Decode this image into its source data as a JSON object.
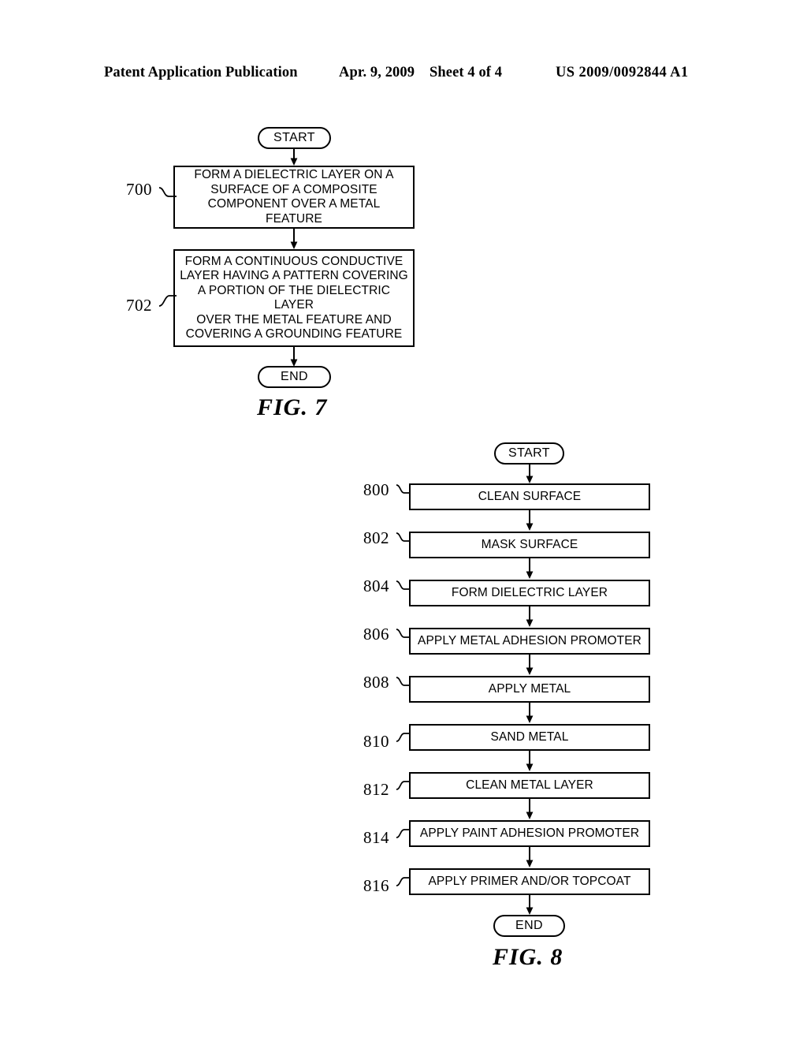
{
  "header": {
    "publication": "Patent Application Publication",
    "date": "Apr. 9, 2009",
    "sheet": "Sheet 4 of 4",
    "patent_number": "US 2009/0092844 A1"
  },
  "figures": [
    {
      "caption": "FIG. 7",
      "start_label": "START",
      "end_label": "END",
      "steps": [
        {
          "ref": "700",
          "text": "FORM A DIELECTRIC LAYER ON A\nSURFACE OF A COMPOSITE\nCOMPONENT OVER A METAL FEATURE"
        },
        {
          "ref": "702",
          "text": "FORM A CONTINUOUS CONDUCTIVE\nLAYER HAVING A PATTERN COVERING\nA PORTION OF THE DIELECTRIC LAYER\nOVER THE METAL FEATURE AND\nCOVERING A GROUNDING FEATURE"
        }
      ]
    },
    {
      "caption": "FIG. 8",
      "start_label": "START",
      "end_label": "END",
      "steps": [
        {
          "ref": "800",
          "text": "CLEAN SURFACE"
        },
        {
          "ref": "802",
          "text": "MASK SURFACE"
        },
        {
          "ref": "804",
          "text": "FORM DIELECTRIC LAYER"
        },
        {
          "ref": "806",
          "text": "APPLY METAL ADHESION PROMOTER"
        },
        {
          "ref": "808",
          "text": "APPLY METAL"
        },
        {
          "ref": "810",
          "text": "SAND METAL"
        },
        {
          "ref": "812",
          "text": "CLEAN METAL LAYER"
        },
        {
          "ref": "814",
          "text": "APPLY PAINT ADHESION PROMOTER"
        },
        {
          "ref": "816",
          "text": "APPLY PRIMER AND/OR TOPCOAT"
        }
      ]
    }
  ]
}
